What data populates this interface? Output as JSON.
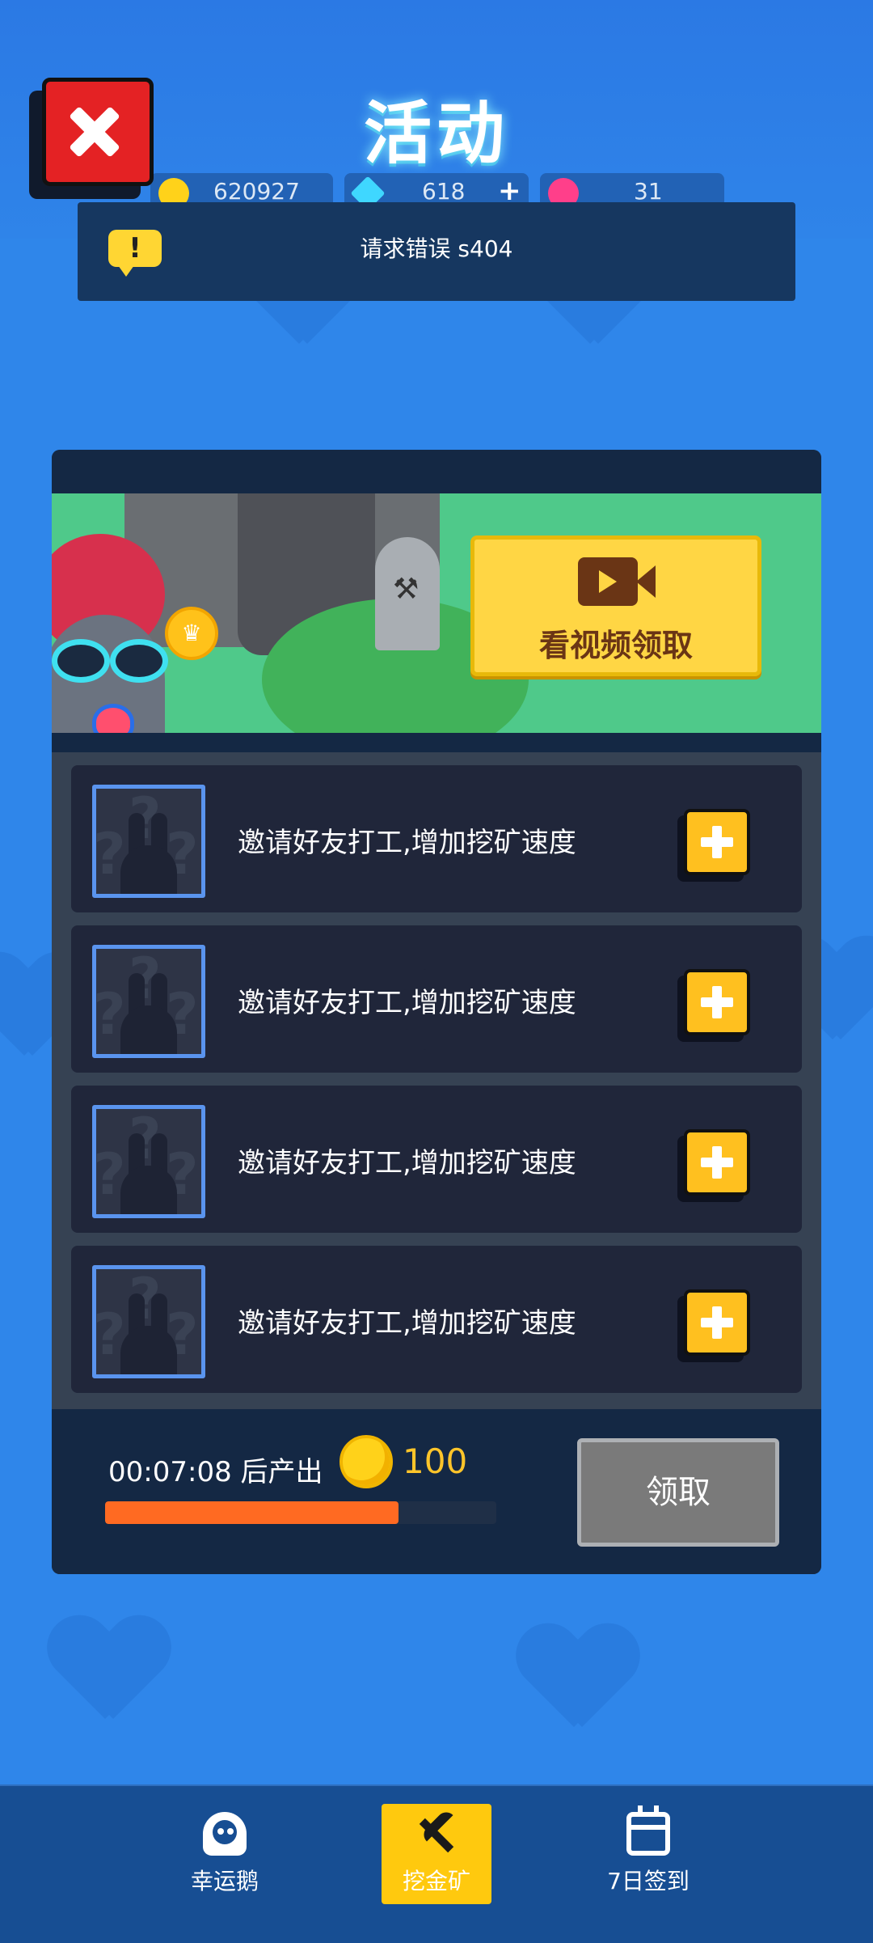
{
  "header": {
    "title": "活动",
    "resources": [
      {
        "name": "gold",
        "value": "620927",
        "icon": "gold-coin-icon",
        "color": "#ffd21a"
      },
      {
        "name": "diamond",
        "value": "618",
        "icon": "diamond-icon",
        "color": "#3fd7ff",
        "plus": "+"
      },
      {
        "name": "ticket",
        "value": "31",
        "icon": "ticket-icon",
        "color": "#ff3f8a"
      }
    ]
  },
  "alert": {
    "text": "请求错误 s404",
    "icon_glyph": "!"
  },
  "banner": {
    "video_button_label": "看视频领取"
  },
  "slots": [
    {
      "text": "邀请好友打工,增加挖矿速度"
    },
    {
      "text": "邀请好友打工,增加挖矿速度"
    },
    {
      "text": "邀请好友打工,增加挖矿速度"
    },
    {
      "text": "邀请好友打工,增加挖矿速度"
    }
  ],
  "mining": {
    "timer_text": "00:07:08 后产出",
    "reward_value": "100",
    "progress": 0.75,
    "claim_label": "领取"
  },
  "nav": {
    "items": [
      {
        "label": "幸运鹅",
        "icon": "goose-icon"
      },
      {
        "label": "挖金矿",
        "icon": "pickaxe-icon",
        "active": true
      },
      {
        "label": "7日签到",
        "icon": "calendar-icon"
      }
    ]
  },
  "colors": {
    "background": "#2f86ea",
    "accent_yellow": "#ffc90e",
    "close_red": "#e42224",
    "progress_orange": "#ff6a22"
  }
}
